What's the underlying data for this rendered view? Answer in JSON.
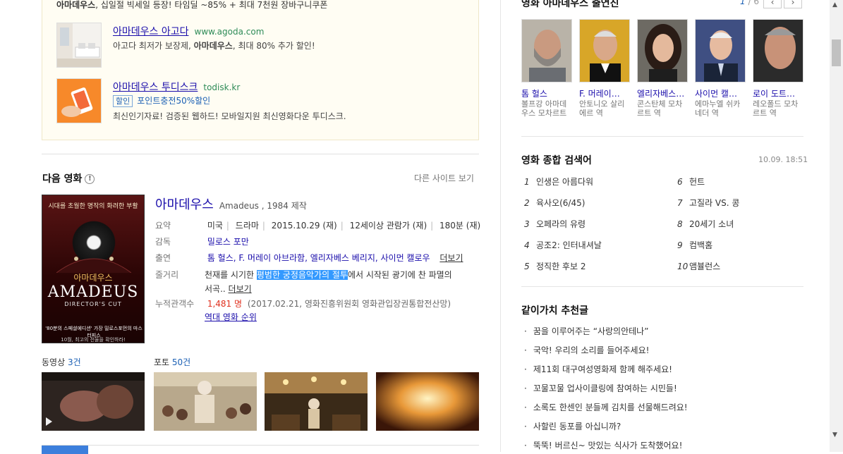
{
  "ads": {
    "top_line_bold": "아마데우스",
    "top_line_rest": ", 십일절 빅세일 등장! 타임딜 ~85% + 최대 7천원 장바구니쿠폰",
    "items": [
      {
        "title": "아마데우스 아고다",
        "url": "www.agoda.com",
        "desc_a": "아고다 최저가 보장제, ",
        "desc_bold": "아마데우스",
        "desc_b": ", 최대 80% 추가 할인!"
      },
      {
        "title": "아마데우스 투디스크",
        "url": "todisk.kr",
        "badge": "할인",
        "badge_text": "포인트충전50%할인",
        "desc": "최신인기자료! 검증된 웹하드! 모바일지원 최신영화다운 투디스크."
      }
    ]
  },
  "next_movie": {
    "section_title": "다음 영화",
    "info_glyph": "!",
    "other_site": "다른 사이트 보기",
    "poster": {
      "tagline": "시대를 초월한 명작의 화려한 부활",
      "kr_title": "아마데우스",
      "en_title": "AMADEUS",
      "cut": "DIRECTOR'S CUT",
      "bottom": "'80분의 스페셜에디션' 가장 밀로스포먼의 마스터피스",
      "release": "10월, 최고의 전율을 확인하라!"
    },
    "title": "아마데우스",
    "subtitle": "Amadeus , 1984 제작",
    "summary_label": "요약",
    "summary": [
      "미국",
      "드라마",
      "2015.10.29 (재)",
      "12세이상 관람가 (재)",
      "180분 (재)"
    ],
    "director_label": "감독",
    "director": "밀로스 포만",
    "cast_label": "출연",
    "cast": "톰 헐스, F. 머레이 아브라함, 엘리자베스 베리지, 사이먼 캘로우",
    "more": "더보기",
    "plot_label": "줄거리",
    "plot_a": "천재를 시기한 ",
    "plot_hl": "평범한 궁정음악가의 절투",
    "plot_b": "에서 시작된 광기에 찬 파멸의",
    "plot_c": "서곡..",
    "audience_label": "누적관객수",
    "audience": "1,481 명",
    "audience_note": "(2017.02.21, 영화진흥위원회 영화관입장권통합전산망)",
    "all_time": "역대 영화 순위",
    "video_label": "동영상 ",
    "video_count": "3건",
    "photo_label": "포토 ",
    "photo_count": "50건"
  },
  "cast_panel": {
    "title": "영화 아마데우스 출연진",
    "page_current": "1",
    "page_total": "/ 6",
    "prev_glyph": "‹",
    "next_glyph": "›",
    "members": [
      {
        "name": "톰 헐스",
        "role": "볼프강 아마데우스 모차르트"
      },
      {
        "name": "F. 머레이…",
        "role": "안토니오 살리에르 역"
      },
      {
        "name": "엘리자베스…",
        "role": "콘스탄체 모차르트 역"
      },
      {
        "name": "사이먼 캘…",
        "role": "에마누엘 쉬카네더 역"
      },
      {
        "name": "로이 도트…",
        "role": "레오폴드 모차르트 역"
      }
    ]
  },
  "search_panel": {
    "title": "영화 종합 검색어",
    "datetime": "10.09. 18:51",
    "ranks": [
      {
        "n": "1",
        "t": "인생은 아름다워"
      },
      {
        "n": "2",
        "t": "육사오(6/45)"
      },
      {
        "n": "3",
        "t": "오페라의 유령"
      },
      {
        "n": "4",
        "t": "공조2: 인터내셔날"
      },
      {
        "n": "5",
        "t": "정직한 후보 2"
      },
      {
        "n": "6",
        "t": "헌트"
      },
      {
        "n": "7",
        "t": "고질라 VS. 콩"
      },
      {
        "n": "8",
        "t": "20세기 소녀"
      },
      {
        "n": "9",
        "t": "컴백홈"
      },
      {
        "n": "10",
        "t": "앰뷸런스"
      }
    ]
  },
  "rec_panel": {
    "title": "같이가치 추천글",
    "items": [
      "꿈을 이루어주는 “사랑의안테나”",
      "국악! 우리의 소리를 들어주세요!",
      "제11회 대구여성영화제 함께 해주세요!",
      "꼬물꼬물 업사이클링에 참여하는 시민들!",
      "소록도 한센인 분들께 김치를 선물해드려요!",
      "사할린 동포를 아십니까?",
      "뚝뚝! 버르신~ 맛있는 식사가 도착했어요!"
    ]
  },
  "scrollbar": {
    "up": "▲",
    "down": "▼"
  }
}
